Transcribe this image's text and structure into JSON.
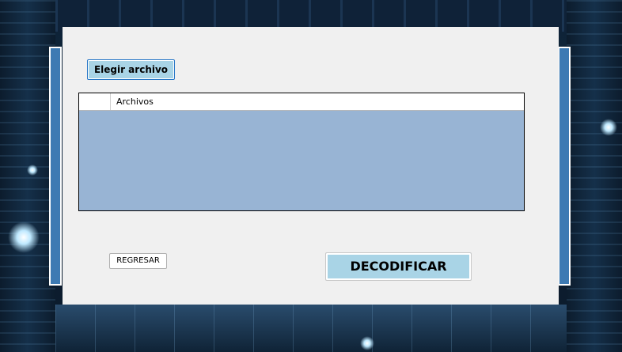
{
  "window": {
    "choose_file_label": "Elegir archivo",
    "files_column_header": "Archivos",
    "back_label": "REGRESAR",
    "decode_label": "DECODIFICAR"
  },
  "colors": {
    "panel": "#f0f0f0",
    "accent_button": "#a9d4e6",
    "grid_background": "#98b4d4",
    "side_bar": "#3d7ab3"
  }
}
